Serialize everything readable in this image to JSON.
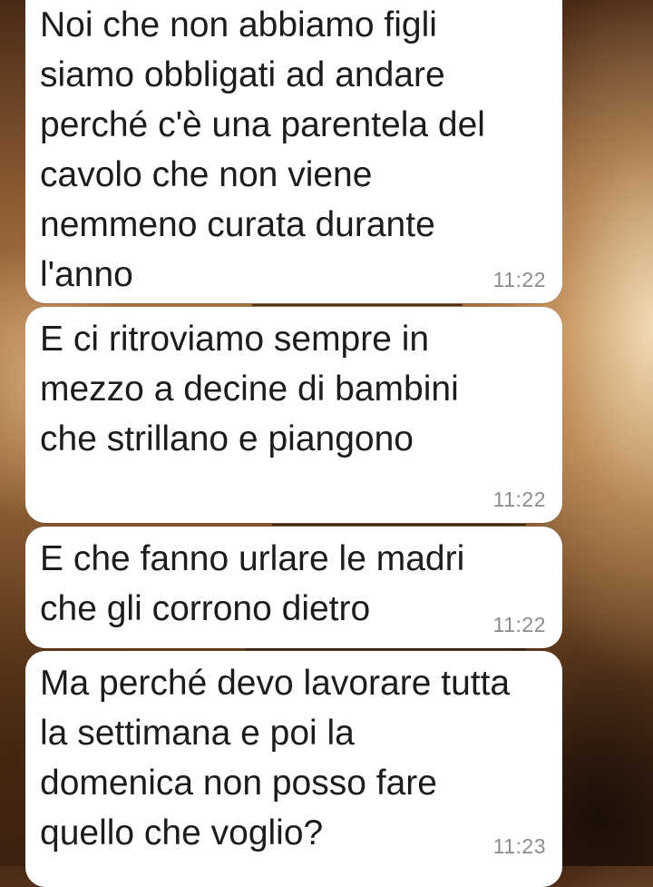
{
  "messages": [
    {
      "text": "Noi che non abbiamo figli siamo obbligati ad andare perché c'è una parentela del cavolo che non viene nemmeno curata durante l'anno",
      "time": "11:22"
    },
    {
      "text": "E ci ritroviamo sempre in mezzo a decine di bambini che strillano e piangono",
      "time": "11:22"
    },
    {
      "text": "E che fanno urlare le madri che gli corrono dietro",
      "time": "11:22"
    },
    {
      "text": "Ma perché devo lavorare tutta la settimana e poi la domenica non posso fare quello che voglio?",
      "time": "11:23"
    }
  ],
  "colors": {
    "bubble": "#ffffff",
    "text": "#1c1c1c",
    "timestamp": "#8c8c8c"
  }
}
